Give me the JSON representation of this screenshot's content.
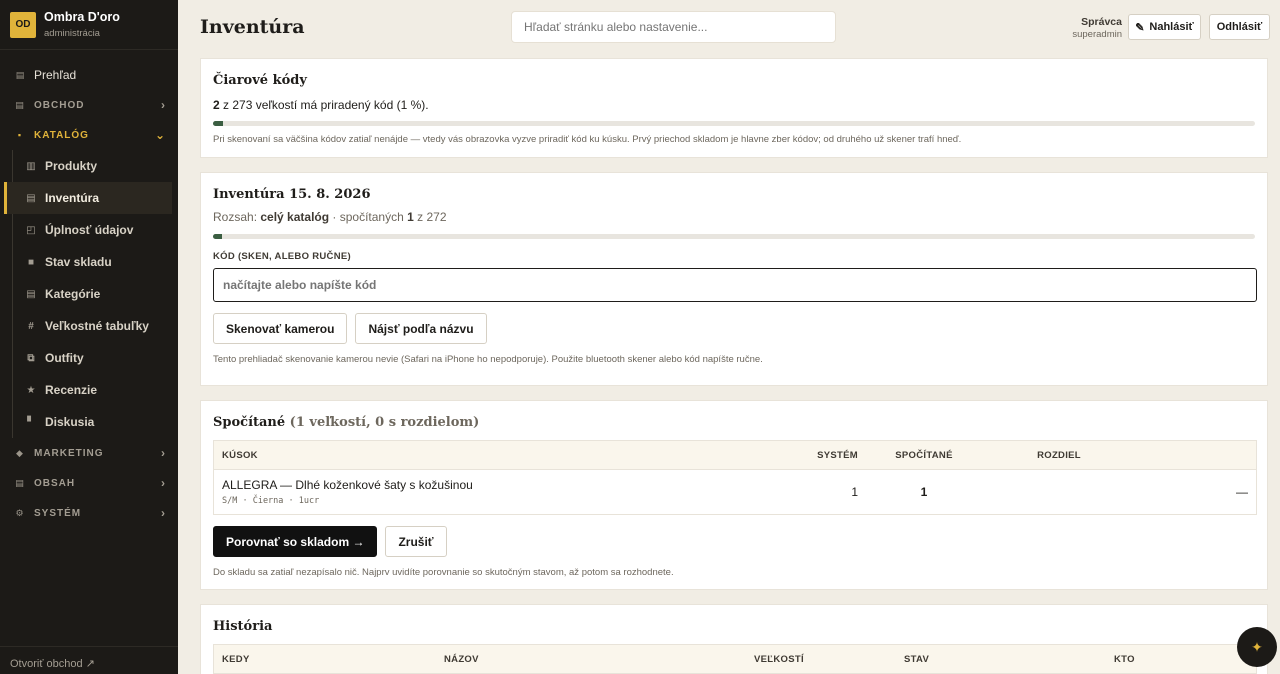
{
  "brand": {
    "badge": "OD",
    "name": "Ombra D'oro",
    "subtitle": "administrácia"
  },
  "nav": {
    "overview": "Prehľad",
    "sections": {
      "shop": "OBCHOD",
      "catalog": "KATALÓG",
      "marketing": "MARKETING",
      "content": "OBSAH",
      "system": "SYSTÉM"
    },
    "catalog_items": [
      "Produkty",
      "Inventúra",
      "Úplnosť údajov",
      "Stav skladu",
      "Kategórie",
      "Veľkostné tabuľky",
      "Outfity",
      "Recenzie",
      "Diskusia"
    ],
    "active_item": "Inventúra",
    "footer_link": "Otvoriť obchod ↗"
  },
  "topbar": {
    "title": "Inventúra",
    "search_placeholder": "Hľadať stránku alebo nastavenie...",
    "user_role": "Správca",
    "user_name": "superadmin",
    "report_label": "Nahlásiť",
    "logout_label": "Odhlásiť"
  },
  "barcodes": {
    "title": "Čiarové kódy",
    "assigned": "2",
    "stat_rest": " z 273 veľkostí má priradený kód (1 %).",
    "progress_percent": 1,
    "note": "Pri skenovaní sa väčšina kódov zatiaľ nenájde — vtedy vás obrazovka vyzve priradiť kód ku kúsku. Prvý priechod skladom je hlavne zber kódov; od druhého už skener trafí hneď."
  },
  "inventory": {
    "title": "Inventúra 15. 8. 2026",
    "scope_label": "Rozsah: ",
    "scope_value": "celý katalóg",
    "counted_label": " · spočítaných ",
    "counted": "1",
    "counted_of": " z 272",
    "progress_percent": 0.4,
    "code_label": "KÓD (SKEN, ALEBO RUČNE)",
    "code_placeholder": "načítajte alebo napíšte kód",
    "scan_button": "Skenovať kamerou",
    "find_button": "Nájsť podľa názvu",
    "note": "Tento prehliadač skenovanie kamerou nevie (Safari na iPhone ho nepodporuje). Použite bluetooth skener alebo kód napíšte ručne."
  },
  "counted": {
    "title": "Spočítané",
    "subtitle": " (1 veľkostí, 0 s rozdielom)",
    "columns": {
      "item": "KÚSOK",
      "system": "SYSTÉM",
      "counted": "SPOČÍTANÉ",
      "diff": "ROZDIEL"
    },
    "rows": [
      {
        "name": "ALLEGRA — Dlhé koženkové šaty s kožušinou",
        "meta": "S/M · Čierna · 1ucr",
        "system": "1",
        "counted": "1",
        "diff": "—"
      }
    ],
    "compare_button": "Porovnať so skladom →",
    "cancel_button": "Zrušiť",
    "note": "Do skladu sa zatiaľ nezapísalo nič. Najprv uvidíte porovnanie so skutočným stavom, až potom sa rozhodnete."
  },
  "history": {
    "title": "História",
    "columns": {
      "when": "KEDY",
      "name": "NÁZOV",
      "sizes": "VEĽKOSTÍ",
      "state": "STAV",
      "who": "KTO"
    }
  },
  "colors": {
    "accent": "#e0b33a",
    "progress": "#3b5e42",
    "sidebar": "#1c1a17",
    "background": "#f1ede4"
  },
  "icons": {
    "fab": "sparkle-icon"
  }
}
